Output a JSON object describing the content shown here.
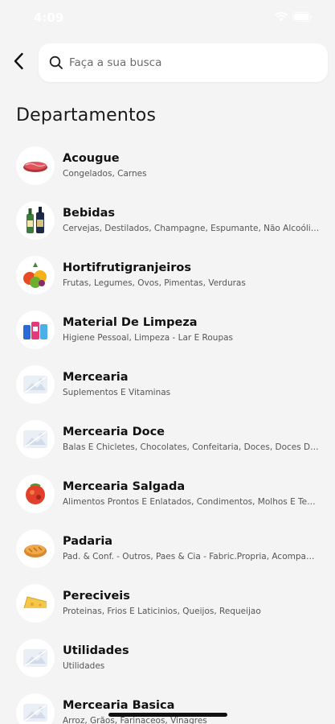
{
  "status": {
    "time": "4:09"
  },
  "header": {
    "back_icon": "chevron-left-icon",
    "search_placeholder": "Faça a sua busca",
    "search_value": ""
  },
  "page": {
    "title": "Departamentos"
  },
  "departments": [
    {
      "name": "Acougue",
      "subtitle": "Congelados, Carnes",
      "thumb": "meat"
    },
    {
      "name": "Bebidas",
      "subtitle": "Cervejas, Destilados, Champagne, Espumante, Não Alcoólicos",
      "thumb": "bottles"
    },
    {
      "name": "Hortifrutigranjeiros",
      "subtitle": "Frutas, Legumes, Ovos, Pimentas, Verduras",
      "thumb": "fruits"
    },
    {
      "name": "Material De Limpeza",
      "subtitle": "Higiene Pessoal, Limpeza - Lar E Roupas",
      "thumb": "cleaning"
    },
    {
      "name": "Mercearia",
      "subtitle": "Suplementos E Vitaminas",
      "thumb": "placeholder"
    },
    {
      "name": "Mercearia Doce",
      "subtitle": "Balas E Chicletes, Chocolates, Confeitaria, Doces, Doces Diversos",
      "thumb": "placeholder"
    },
    {
      "name": "Mercearia Salgada",
      "subtitle": "Alimentos Prontos E Enlatados, Condimentos, Molhos E Temperos",
      "thumb": "salty"
    },
    {
      "name": "Padaria",
      "subtitle": "Pad. & Conf. - Outros, Paes & Cia - Fabric.Propria, Acompanhamentos",
      "thumb": "bread"
    },
    {
      "name": "Pereciveis",
      "subtitle": "Proteinas, Frios E Laticinios, Queijos, Requeijao",
      "thumb": "cheese"
    },
    {
      "name": "Utilidades",
      "subtitle": "Utilidades",
      "thumb": "placeholder"
    },
    {
      "name": "Mercearia Basica",
      "subtitle": "Arroz, Grãos, Farinaceos, Vinagres",
      "thumb": "placeholder"
    }
  ],
  "colors": {
    "background": "#f4f4f4",
    "card": "#ffffff",
    "text": "#111111",
    "subtext": "#555555"
  }
}
